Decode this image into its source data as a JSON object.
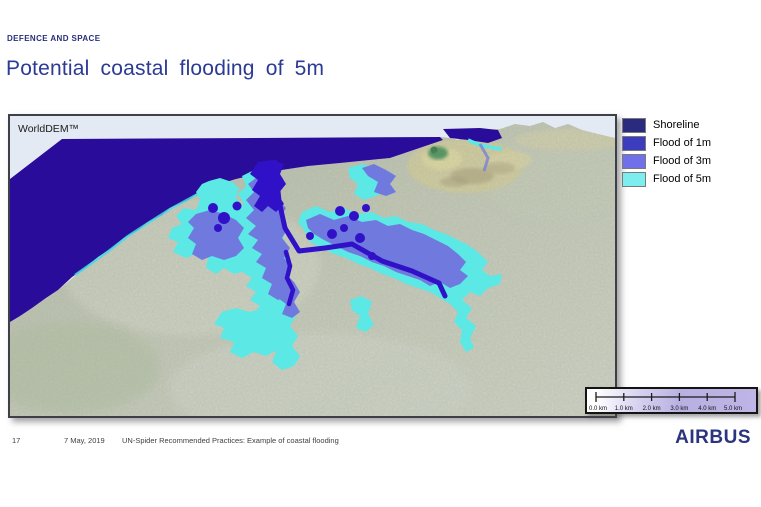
{
  "header": {
    "eyebrow": "DEFENCE AND SPACE",
    "title": "Potential coastal flooding of 5m"
  },
  "map": {
    "label": "WorldDEM™",
    "colors": {
      "sky": "#e4eaf3",
      "sea": "#2a0c9a",
      "terrain_light": "#d4d9cb",
      "terrain_dark": "#b7bead",
      "mountain_tan": "#dcd49e",
      "mountain_green": "#3f9152",
      "flood_1m": "#3011c8",
      "flood_3m": "#7079dd",
      "flood_5m": "#5ce8e4"
    }
  },
  "legend": {
    "items": [
      {
        "label": "Shoreline",
        "color": "#2a2a7e"
      },
      {
        "label": "Flood of 1m",
        "color": "#3c3cbe"
      },
      {
        "label": "Flood of 3m",
        "color": "#7070e8"
      },
      {
        "label": "Flood of 5m",
        "color": "#7deef0"
      }
    ]
  },
  "scalebar": {
    "labels": [
      "0.0 km",
      "1.0 km",
      "2.0 km",
      "3.0 km",
      "4.0 km",
      "5.0 km"
    ]
  },
  "footer": {
    "page": "17",
    "date": "7 May, 2019",
    "note": "UN-Spider Recommended Practices: Example of coastal flooding",
    "brand": "AIRBUS"
  }
}
